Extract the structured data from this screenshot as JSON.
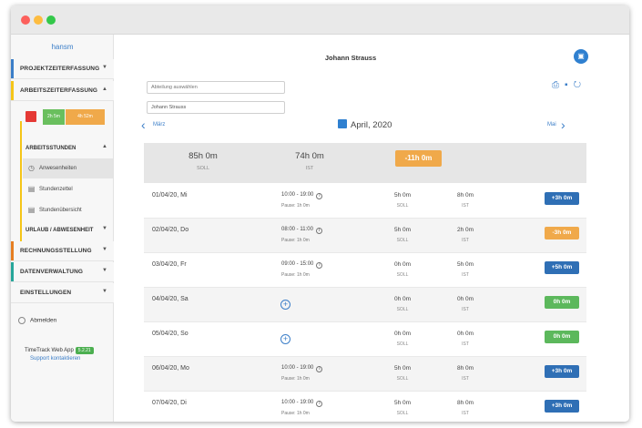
{
  "sidebar": {
    "brand": "hansm",
    "nav": [
      {
        "label": "PROJEKTZEITERFASSUNG",
        "color": "#3b7ec8"
      },
      {
        "label": "ARBEITSZEITERFASSUNG",
        "color": "#f5c518"
      },
      {
        "label": "RECHNUNGSSTELLUNG",
        "color": "#e67e22"
      },
      {
        "label": "DATENVERWALTUNG",
        "color": "#26a69a"
      },
      {
        "label": "EINSTELLUNGEN",
        "color": ""
      }
    ],
    "widget": {
      "green_text": "2h 5m",
      "orange_text": "4h 52m"
    },
    "sub_header": "ARBEITSSTUNDEN",
    "sub_items": [
      "Anwesenheiten",
      "Stundenzettel",
      "Stundenübersicht"
    ],
    "sub_header2": "URLAUB / ABWESENHEIT",
    "logout": "Abmelden",
    "app_label": "TimeTrack Web App",
    "version": "5.2.21",
    "support": "Support kontaktieren"
  },
  "header": {
    "user": "Johann Strauss",
    "department_placeholder": "Abteilung auswählen",
    "user_field": "Johann Strauss"
  },
  "month": {
    "prev": "März",
    "current": "April, 2020",
    "next": "Mai"
  },
  "summary": {
    "soll_value": "85h 0m",
    "soll_label": "SOLL",
    "ist_value": "74h 0m",
    "ist_label": "IST",
    "diff": "-11h 0m"
  },
  "rows": [
    {
      "date": "01/04/20, Mi",
      "time": "10:00 - 19:00",
      "pause": "Pause: 1h 0m",
      "soll": "5h 0m",
      "ist": "8h 0m",
      "diff": "+3h 0m",
      "status": "blue",
      "soll_label": "SOLL",
      "ist_label": "IST"
    },
    {
      "date": "02/04/20, Do",
      "time": "08:00 - 11:00",
      "pause": "Pause: 1h 0m",
      "soll": "5h 0m",
      "ist": "2h 0m",
      "diff": "-3h 0m",
      "status": "orange",
      "soll_label": "SOLL",
      "ist_label": "IST"
    },
    {
      "date": "03/04/20, Fr",
      "time": "09:00 - 15:00",
      "pause": "Pause: 1h 0m",
      "soll": "0h 0m",
      "ist": "5h 0m",
      "diff": "+5h 0m",
      "status": "blue",
      "soll_label": "SOLL",
      "ist_label": "IST"
    },
    {
      "date": "04/04/20, Sa",
      "time": "",
      "pause": "",
      "soll": "0h 0m",
      "ist": "0h 0m",
      "diff": "0h 0m",
      "status": "green",
      "soll_label": "SOLL",
      "ist_label": "IST"
    },
    {
      "date": "05/04/20, So",
      "time": "",
      "pause": "",
      "soll": "0h 0m",
      "ist": "0h 0m",
      "diff": "0h 0m",
      "status": "green",
      "soll_label": "SOLL",
      "ist_label": "IST"
    },
    {
      "date": "06/04/20, Mo",
      "time": "10:00 - 19:00",
      "pause": "Pause: 1h 0m",
      "soll": "5h 0m",
      "ist": "8h 0m",
      "diff": "+3h 0m",
      "status": "blue",
      "soll_label": "SOLL",
      "ist_label": "IST"
    },
    {
      "date": "07/04/20, Di",
      "time": "10:00 - 19:00",
      "pause": "Pause: 1h 0m",
      "soll": "5h 0m",
      "ist": "8h 0m",
      "diff": "+3h 0m",
      "status": "blue",
      "soll_label": "SOLL",
      "ist_label": "IST"
    }
  ],
  "colors": {
    "blue": "#2f6fb5",
    "orange": "#f0a94a",
    "green": "#5cb85c",
    "accent": "#3b7ec8"
  }
}
